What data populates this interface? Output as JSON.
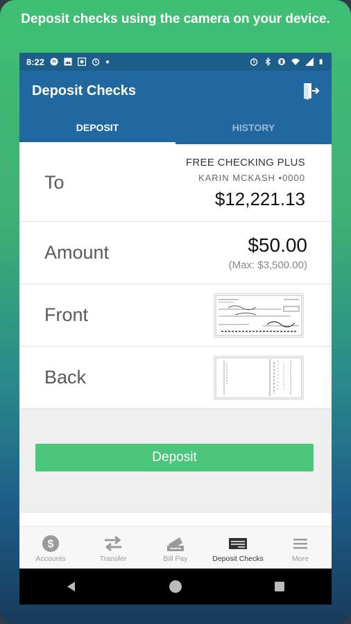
{
  "headline": "Deposit checks using the camera on your device.",
  "status_bar": {
    "time": "8:22",
    "left_icons": [
      "podcast-icon",
      "image-icon",
      "photo-icon",
      "alarm-icon",
      "dot-icon"
    ],
    "right_icons": [
      "alarm-icon",
      "bluetooth-icon",
      "vibrate-icon",
      "wifi-icon",
      "signal-icon",
      "battery-icon"
    ]
  },
  "app_bar": {
    "title": "Deposit Checks",
    "exit_icon": "exit-icon"
  },
  "tabs": [
    {
      "label": "DEPOSIT",
      "active": true
    },
    {
      "label": "HISTORY",
      "active": false
    }
  ],
  "form": {
    "to": {
      "label": "To",
      "account_name": "FREE CHECKING PLUS",
      "account_owner": "KARIN MCKASH •0000",
      "balance": "$12,221.13"
    },
    "amount": {
      "label": "Amount",
      "value": "$50.00",
      "max": "(Max: $3,500.00)"
    },
    "front": {
      "label": "Front"
    },
    "back": {
      "label": "Back"
    }
  },
  "deposit_button": "Deposit",
  "bottom_nav": [
    {
      "label": "Accounts",
      "icon": "dollar-icon",
      "active": false
    },
    {
      "label": "Transfer",
      "icon": "transfer-icon",
      "active": false
    },
    {
      "label": "Bill Pay",
      "icon": "bill-pay-icon",
      "active": false
    },
    {
      "label": "Deposit Checks",
      "icon": "check-icon",
      "active": true
    },
    {
      "label": "More",
      "icon": "menu-icon",
      "active": false
    }
  ],
  "colors": {
    "app_bar": "#2168a0",
    "status_bar": "#1e5e8a",
    "deposit_button": "#4cc67a",
    "background_green": "#3fbf74"
  }
}
